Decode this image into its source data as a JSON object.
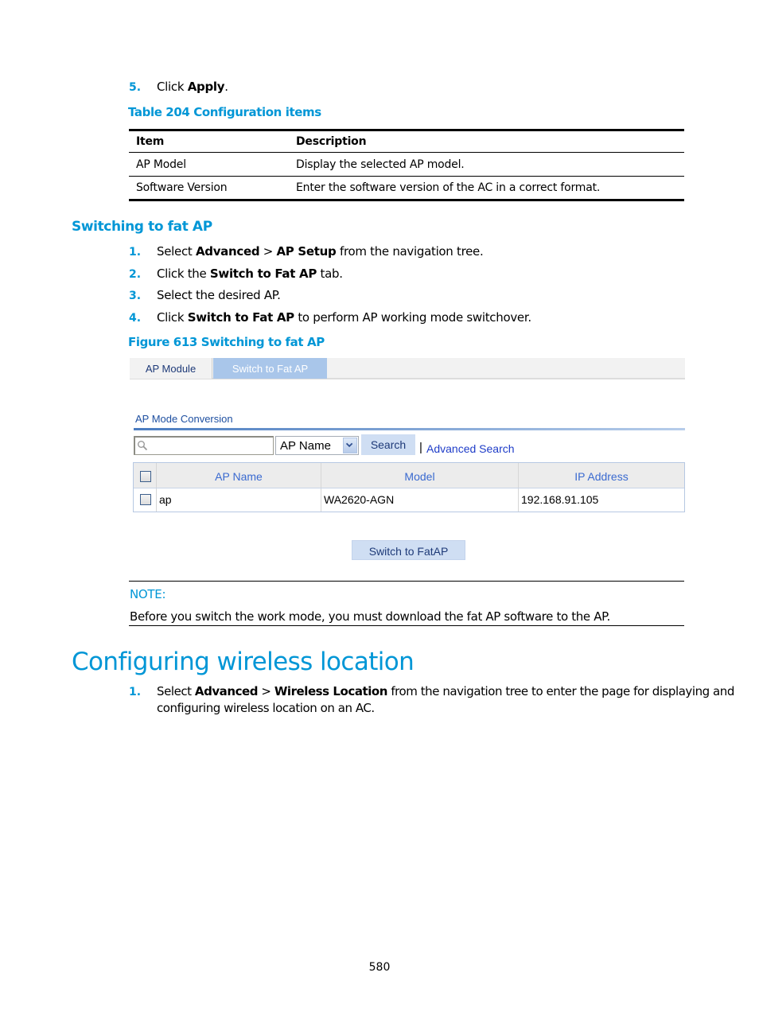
{
  "steps_top": [
    {
      "num": "5.",
      "parts": [
        {
          "t": "Click "
        },
        {
          "b": "Apply"
        },
        {
          "t": "."
        }
      ]
    }
  ],
  "table_caption": "Table 204 Configuration items",
  "config_table": {
    "headers": [
      "Item",
      "Description"
    ],
    "rows": [
      [
        "AP Model",
        "Display the selected AP model."
      ],
      [
        "Software Version",
        "Enter the software version of the AC in a correct format."
      ]
    ]
  },
  "section_heading": "Switching to fat AP",
  "steps_switch": [
    {
      "num": "1.",
      "parts": [
        {
          "t": "Select "
        },
        {
          "b": "Advanced"
        },
        {
          "t": " > "
        },
        {
          "b": "AP Setup"
        },
        {
          "t": " from the navigation tree."
        }
      ]
    },
    {
      "num": "2.",
      "parts": [
        {
          "t": "Click the "
        },
        {
          "b": "Switch to Fat AP"
        },
        {
          "t": " tab."
        }
      ]
    },
    {
      "num": "3.",
      "parts": [
        {
          "t": "Select the desired AP."
        }
      ]
    },
    {
      "num": "4.",
      "parts": [
        {
          "t": "Click "
        },
        {
          "b": "Switch to Fat AP"
        },
        {
          "t": " to perform AP working mode switchover."
        }
      ]
    }
  ],
  "figure_caption": "Figure 613 Switching to fat AP",
  "ui": {
    "tabs": [
      {
        "label": "AP Module",
        "active": false
      },
      {
        "label": "Switch to Fat AP",
        "active": true
      }
    ],
    "section_title": "AP Mode Conversion",
    "search": {
      "placeholder": "",
      "value": "",
      "field_select": "AP Name",
      "search_button": "Search",
      "separator": "|",
      "advanced_link": "Advanced Search"
    },
    "ap_table": {
      "headers": [
        "AP Name",
        "Model",
        "IP Address"
      ],
      "rows": [
        {
          "checked": false,
          "ap_name": "ap",
          "model": "WA2620-AGN",
          "ip": "192.168.91.105"
        }
      ]
    },
    "switch_button": "Switch to FatAP"
  },
  "note": {
    "label": "NOTE:",
    "text": "Before you switch the work mode, you must download the fat AP software to the AP."
  },
  "chapter_heading": "Configuring wireless location",
  "steps_location": [
    {
      "num": "1.",
      "line1": [
        {
          "t": "Select "
        },
        {
          "b": "Advanced"
        },
        {
          "t": " > "
        },
        {
          "b": "Wireless Location"
        },
        {
          "t": " from the navigation tree to enter the page for displaying and"
        }
      ],
      "line2": "configuring wireless location on an AC."
    }
  ],
  "page_number": "580",
  "colors": {
    "accent": "#0096d6",
    "ui_link": "#1e3cc8",
    "ui_tab_active": "#a9c6ea",
    "ui_button": "#cfdef3"
  }
}
